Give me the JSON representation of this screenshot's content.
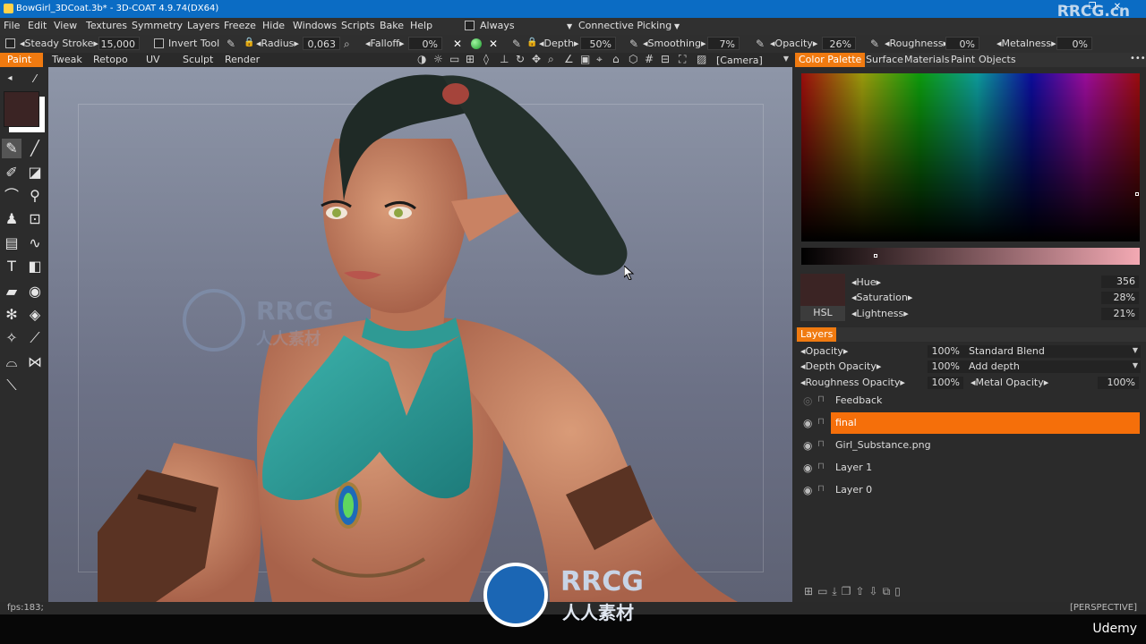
{
  "window": {
    "title": "BowGirl_3DCoat.3b* - 3D-COAT 4.9.74(DX64)",
    "watermark": "RRCG.cn",
    "controls": [
      "—",
      "❐",
      "✕"
    ]
  },
  "menu": {
    "items": [
      "File",
      "Edit",
      "View",
      "Textures",
      "Symmetry",
      "Layers",
      "Freeze",
      "Hide",
      "Windows",
      "Scripts",
      "Bake",
      "Help"
    ],
    "always_label": "Always",
    "picking_label": "Connective Picking"
  },
  "toolbar": {
    "steady_stroke": "Steady  Stroke",
    "steady_value": "15,000",
    "invert_tool": "Invert  Tool",
    "radius": "Radius",
    "radius_value": "0,063",
    "falloff": "Falloff",
    "falloff_value": "0%",
    "depth": "Depth",
    "depth_value": "50%",
    "smoothing": "Smoothing",
    "smoothing_value": "7%",
    "opacity": "Opacity",
    "opacity_value": "26%",
    "roughness": "Roughness",
    "roughness_value": "0%",
    "metalness": "Metalness",
    "metalness_value": "0%"
  },
  "room_tabs": [
    "Paint",
    "Tweak",
    "Retopo",
    "UV",
    "Sculpt",
    "Render"
  ],
  "camera_dropdown": "[Camera]",
  "right_tabs": [
    "Color Palette",
    "Surface",
    "Materials",
    "Paint",
    "Objects"
  ],
  "color": {
    "hue_label": "Hue",
    "hue": "356",
    "sat_label": "Saturation",
    "sat": "28%",
    "light_label": "Lightness",
    "light": "21%",
    "mode_button": "HSL",
    "current": "#3b2424"
  },
  "layers": {
    "tab_label": "Layers",
    "opacity_label": "Opacity",
    "opacity": "100%",
    "blend": "Standard  Blend",
    "depth_opacity_label": "Depth  Opacity",
    "depth_opacity": "100%",
    "depth_mode": "Add  depth",
    "roughness_opacity_label": "Roughness  Opacity",
    "roughness_opacity": "100%",
    "metal_opacity_label": "Metal  Opacity",
    "metal_opacity": "100%",
    "items": [
      {
        "name": "Feedback",
        "visible": false,
        "active": false
      },
      {
        "name": "final",
        "visible": true,
        "active": true
      },
      {
        "name": "Girl_Substance.png",
        "visible": true,
        "active": false
      },
      {
        "name": "Layer  1",
        "visible": true,
        "active": false
      },
      {
        "name": "Layer  0",
        "visible": true,
        "active": false
      }
    ]
  },
  "status": {
    "fps": "fps:183;",
    "view_mode": "[PERSPECTIVE]"
  },
  "branding": {
    "rrcg": "RRCG",
    "rrcg_cn": "人人素材",
    "udemy": "Udemy"
  },
  "colors": {
    "accent": "#f07a10",
    "titlebar": "#0b6cc4"
  }
}
